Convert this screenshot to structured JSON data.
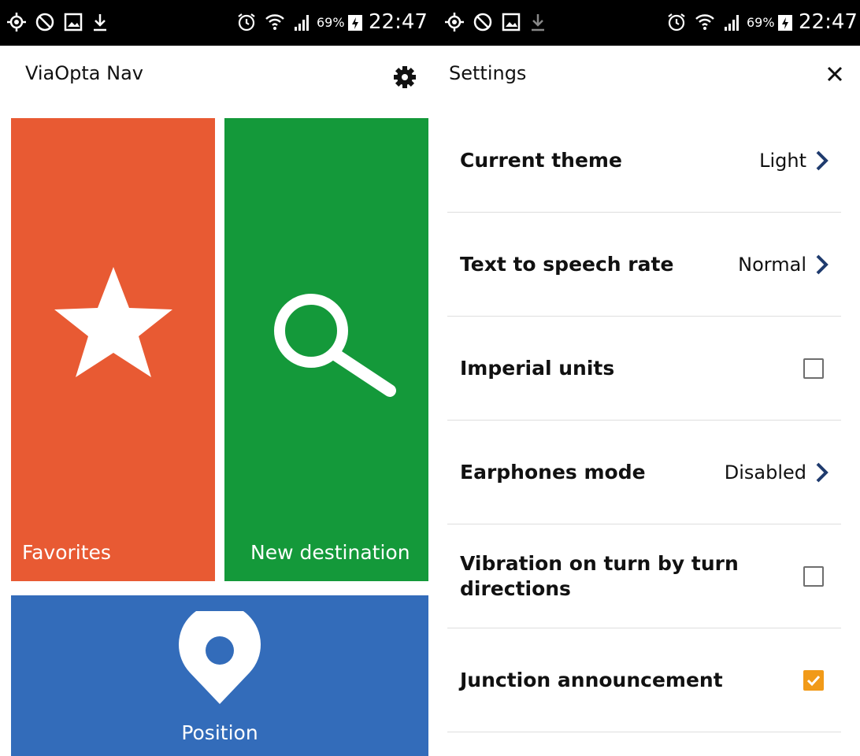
{
  "status_bar": {
    "battery": "69%",
    "time": "22:47"
  },
  "home": {
    "title": "ViaOpta Nav",
    "tiles": {
      "favorites": "Favorites",
      "new_destination": "New destination",
      "position": "Position"
    },
    "colors": {
      "favorites": "#e85a33",
      "new_destination": "#14993a",
      "position": "#336cba"
    }
  },
  "settings": {
    "title": "Settings",
    "rows": [
      {
        "label": "Current theme",
        "value": "Light"
      },
      {
        "label": "Text to speech rate",
        "value": "Normal"
      },
      {
        "label": "Imperial units",
        "checked": false
      },
      {
        "label": "Earphones mode",
        "value": "Disabled"
      },
      {
        "label": "Vibration on turn by turn directions",
        "checked": false
      },
      {
        "label": "Junction announcement",
        "checked": true
      }
    ],
    "colors": {
      "accent": "#f19a18",
      "chevron": "#1f3b6e"
    }
  }
}
